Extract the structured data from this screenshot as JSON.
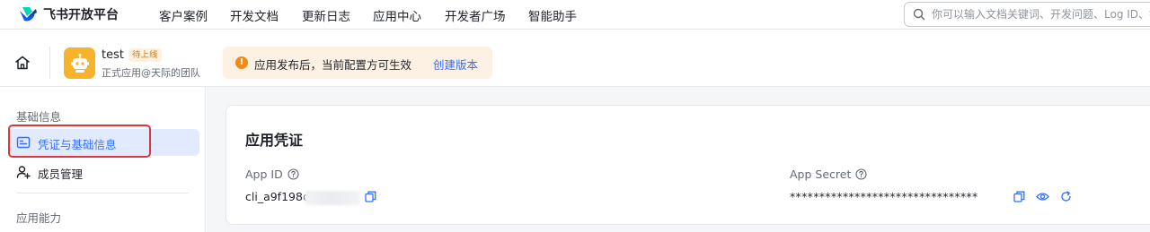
{
  "brand": {
    "name": "飞书开放平台"
  },
  "nav": {
    "items": [
      "客户案例",
      "开发文档",
      "更新日志",
      "应用中心",
      "开发者广场",
      "智能助手"
    ]
  },
  "search": {
    "placeholder": "你可以输入文档关键词、开发问题、Log ID、错"
  },
  "app": {
    "name": "test",
    "status": "待上线",
    "subtitle": "正式应用@天际的团队"
  },
  "notice": {
    "text": "应用发布后，当前配置方可生效",
    "link": "创建版本"
  },
  "sidebar": {
    "section_basic": "基础信息",
    "items": [
      {
        "label": "凭证与基础信息",
        "active": true
      },
      {
        "label": "成员管理",
        "active": false
      }
    ],
    "section_capability": "应用能力"
  },
  "credentials": {
    "title": "应用凭证",
    "app_id_label": "App ID",
    "app_id_value": "cli_a9f198d",
    "app_secret_label": "App Secret",
    "app_secret_value": "********************************"
  },
  "colors": {
    "accent": "#3370ff",
    "highlight": "#e0353d",
    "warning": "#f28a1a",
    "status_badge": "#de7802"
  }
}
